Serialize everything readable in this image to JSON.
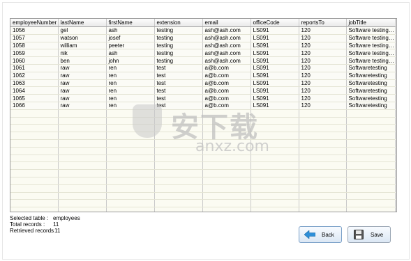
{
  "table": {
    "columns": [
      "employeeNumber",
      "lastName",
      "firstName",
      "extension",
      "email",
      "officeCode",
      "reportsTo",
      "jobTitle"
    ],
    "rows": [
      [
        "1056",
        "gel",
        "ash",
        "testing",
        "ash@ash.com",
        "LS091",
        "120",
        "Software testing ..."
      ],
      [
        "1057",
        "watson",
        "josef",
        "testing",
        "ash@ash.com",
        "LS091",
        "120",
        "Software testing ..."
      ],
      [
        "1058",
        "william",
        "peeter",
        "testing",
        "ash@ash.com",
        "LS091",
        "120",
        "Software testing ..."
      ],
      [
        "1059",
        "nik",
        "ash",
        "testing",
        "ash@ash.com",
        "LS091",
        "120",
        "Software testing ..."
      ],
      [
        "1060",
        "ben",
        "john",
        "testing",
        "ash@ash.com",
        "LS091",
        "120",
        "Software testing ..."
      ],
      [
        "1061",
        "raw",
        "ren",
        "test",
        "a@b.com",
        "LS091",
        "120",
        "Softwaretesting"
      ],
      [
        "1062",
        "raw",
        "ren",
        "test",
        "a@b.com",
        "LS091",
        "120",
        "Softwaretesting"
      ],
      [
        "1063",
        "raw",
        "ren",
        "test",
        "a@b.com",
        "LS091",
        "120",
        "Softwaretesting"
      ],
      [
        "1064",
        "raw",
        "ren",
        "test",
        "a@b.com",
        "LS091",
        "120",
        "Softwaretesting"
      ],
      [
        "1065",
        "raw",
        "ren",
        "test",
        "a@b.com",
        "LS091",
        "120",
        "Softwaretesting"
      ],
      [
        "1066",
        "raw",
        "ren",
        "test",
        "a@b.com",
        "LS091",
        "120",
        "Softwaretesting"
      ]
    ]
  },
  "info": {
    "selected_table_label": "Selected table :",
    "selected_table_value": "employees",
    "total_records_label": "Total records :",
    "total_records_value": "11",
    "retrieved_records_label": "Retrieved records :",
    "retrieved_records_value": "11"
  },
  "buttons": {
    "back_label": "Back",
    "back_icon": "arrow-left-icon",
    "save_label": "Save",
    "save_icon": "floppy-disk-icon"
  },
  "watermark": {
    "cn_text": "安下载",
    "url_text": "anxz.com"
  },
  "colors": {
    "back_arrow": "#2e8fd8",
    "header_border": "#a0a0a0"
  }
}
